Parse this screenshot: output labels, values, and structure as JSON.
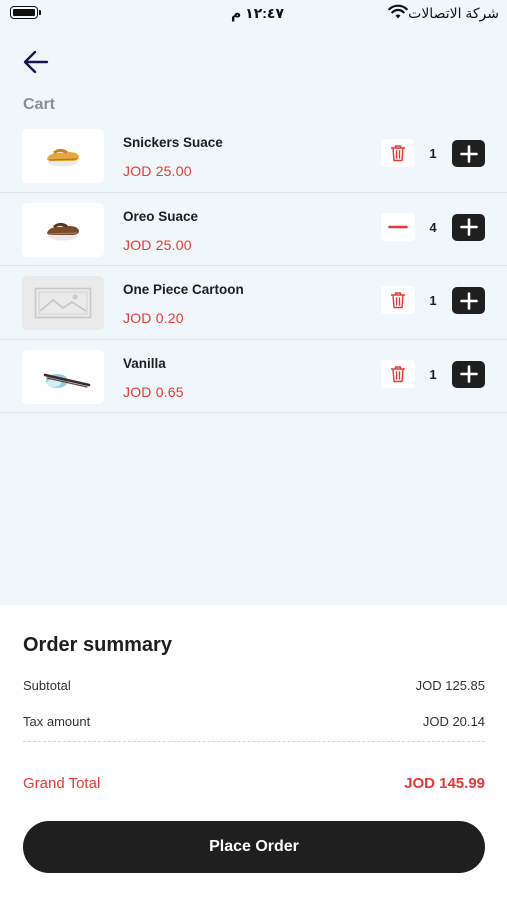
{
  "status_bar": {
    "time": "١٢:٤٧ م",
    "carrier": "شركة الاتصالات"
  },
  "header": {
    "title": "Cart"
  },
  "cart": {
    "items": [
      {
        "name": "Snickers Suace",
        "price": "JOD 25.00",
        "quantity": "1",
        "left_control": "trash-icon",
        "image": "sandal-photo"
      },
      {
        "name": "Oreo Suace",
        "price": "JOD 25.00",
        "quantity": "4",
        "left_control": "minus-icon",
        "image": "sandal-photo"
      },
      {
        "name": "One Piece Cartoon",
        "price": "JOD 0.20",
        "quantity": "1",
        "left_control": "trash-icon",
        "image": "image-placeholder-icon"
      },
      {
        "name": "Vanilla",
        "price": "JOD 0.65",
        "quantity": "1",
        "left_control": "trash-icon",
        "image": "pen-photo"
      }
    ]
  },
  "summary": {
    "title": "Order summary",
    "subtotal_label": "Subtotal",
    "subtotal_value": "JOD 125.85",
    "tax_label": "Tax amount",
    "tax_value": "JOD 20.14",
    "grand_label": "Grand Total",
    "grand_value": "JOD 145.99",
    "place_order_label": "Place Order"
  },
  "colors": {
    "accent_red": "#e53935",
    "dark_button": "#1f1f1f",
    "background": "#f0f7fb"
  }
}
